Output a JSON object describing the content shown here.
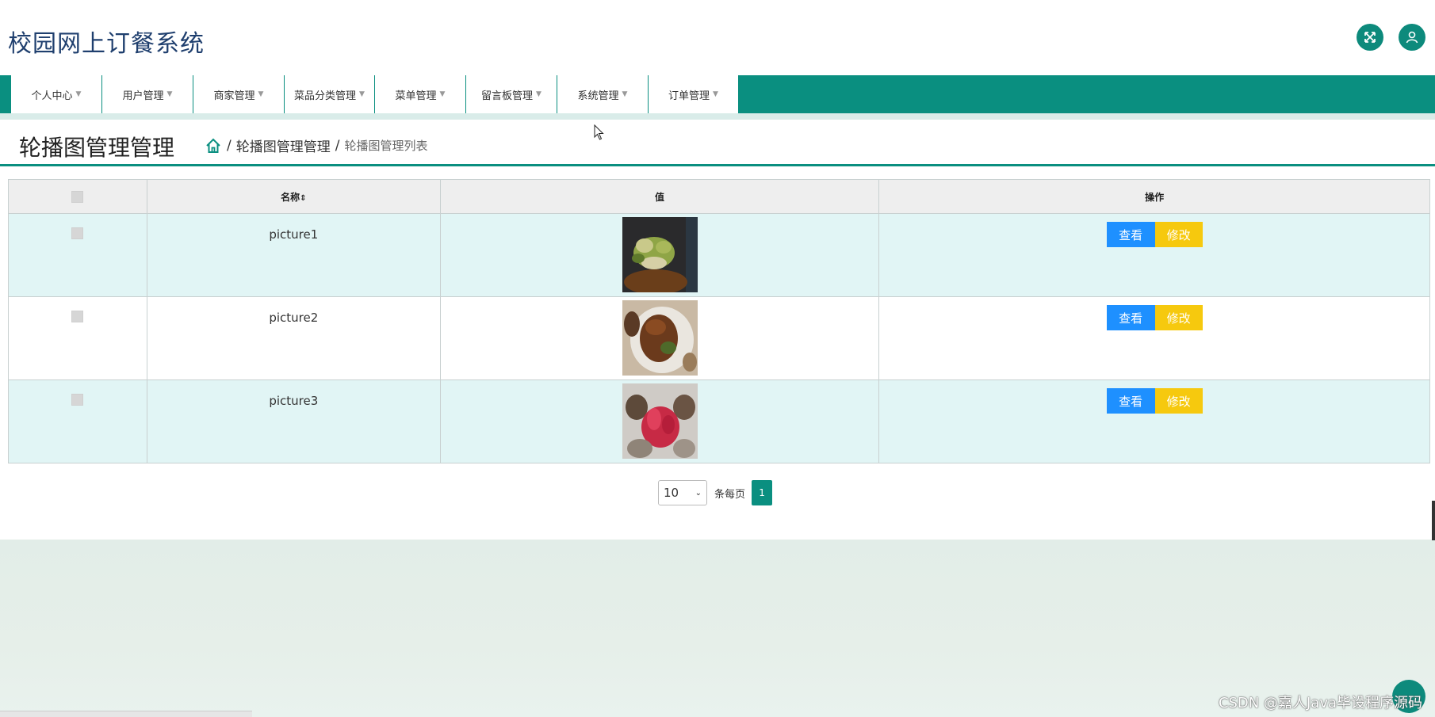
{
  "app": {
    "title": "校园网上订餐系统"
  },
  "header": {
    "fullscreen_icon": "fullscreen-icon",
    "user_icon": "user-icon"
  },
  "nav": {
    "items": [
      {
        "label": "个人中心"
      },
      {
        "label": "用户管理"
      },
      {
        "label": "商家管理"
      },
      {
        "label": "菜品分类管理"
      },
      {
        "label": "菜单管理"
      },
      {
        "label": "留言板管理"
      },
      {
        "label": "系统管理"
      },
      {
        "label": "订单管理"
      }
    ]
  },
  "page": {
    "title": "轮播图管理管理",
    "breadcrumb": {
      "sep": "/",
      "level1": "轮播图管理管理",
      "level2": "轮播图管理列表"
    }
  },
  "table": {
    "columns": {
      "name": "名称",
      "sort_icon": "⇕",
      "value": "值",
      "ops": "操作"
    },
    "rows": [
      {
        "name": "picture1",
        "view": "查看",
        "edit": "修改"
      },
      {
        "name": "picture2",
        "view": "查看",
        "edit": "修改"
      },
      {
        "name": "picture3",
        "view": "查看",
        "edit": "修改"
      }
    ]
  },
  "pager": {
    "page_size": "10",
    "per_page_label": "条每页",
    "current_page": "1"
  },
  "watermark": "CSDN @嘉人Java毕设程序源码",
  "colors": {
    "theme": "#0a8f80",
    "view_button": "#1e90ff",
    "edit_button": "#f6c90e"
  }
}
